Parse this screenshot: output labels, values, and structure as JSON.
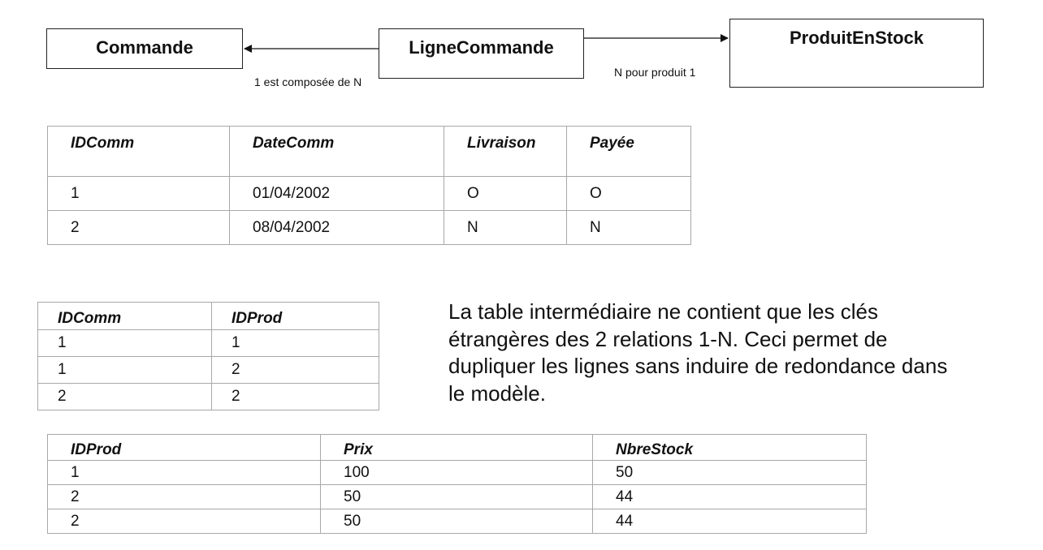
{
  "entities": {
    "commande": "Commande",
    "ligne_commande": "LigneCommande",
    "produit_en_stock": "ProduitEnStock"
  },
  "relations": {
    "ligne_to_commande": "1 est composée de N",
    "ligne_to_produit": "N pour produit 1"
  },
  "table_commande": {
    "headers": [
      "IDComm",
      "DateComm",
      "Livraison",
      "Payée"
    ],
    "rows": [
      [
        "1",
        "01/04/2002",
        "O",
        "O"
      ],
      [
        "2",
        "08/04/2002",
        "N",
        "N"
      ]
    ]
  },
  "table_ligne_commande": {
    "headers": [
      "IDComm",
      "IDProd"
    ],
    "rows": [
      [
        "1",
        "1"
      ],
      [
        "1",
        "2"
      ],
      [
        "2",
        "2"
      ]
    ]
  },
  "table_produit": {
    "headers": [
      "IDProd",
      "Prix",
      "NbreStock"
    ],
    "rows": [
      [
        "1",
        "100",
        "50"
      ],
      [
        "2",
        "50",
        "44"
      ],
      [
        "2",
        "50",
        "44"
      ]
    ]
  },
  "explanation": "La table intermédiaire ne contient que les clés étrangères des 2  relations 1-N.  Ceci permet de dupliquer les lignes sans induire de redondance dans le modèle."
}
